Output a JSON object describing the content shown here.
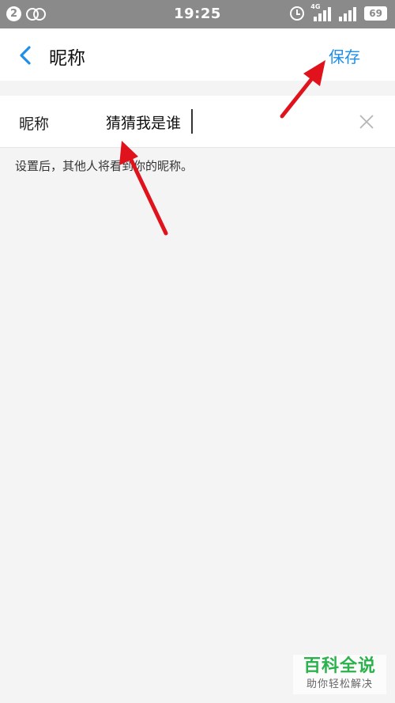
{
  "status_bar": {
    "notification_count": "2",
    "time": "19:25",
    "network_label": "4G",
    "battery": "69",
    "icons": [
      "notification-badge",
      "rings-app-icon",
      "alarm-icon",
      "signal-icon",
      "battery-icon"
    ]
  },
  "nav": {
    "back_icon": "chevron-left-icon",
    "title": "昵称",
    "save_label": "保存"
  },
  "form": {
    "label": "昵称",
    "value": "猜猜我是谁",
    "clear_icon": "close-icon",
    "hint": "设置后，其他人将看到你的昵称。"
  },
  "watermark": {
    "title": "百科全说",
    "subtitle": "助你轻松解决"
  },
  "colors": {
    "accent": "#1f8ee8",
    "annotation_arrow": "#e0121b",
    "status_bar": "#8a8a8a",
    "background": "#f4f4f4",
    "watermark_green": "#2bb24c"
  }
}
